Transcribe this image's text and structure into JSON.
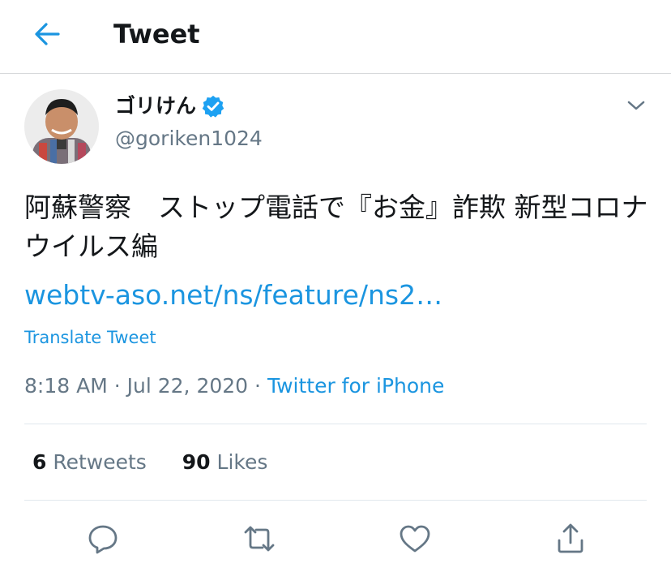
{
  "header": {
    "title": "Tweet"
  },
  "user": {
    "display_name": "ゴリけん",
    "handle": "@goriken1024"
  },
  "tweet": {
    "text": "阿蘇警察　ストップ電話で『お金』詐欺 新型コロナウイルス編",
    "link_text": "webtv-aso.net/ns/feature/ns2…",
    "translate_label": "Translate Tweet",
    "time": "8:18 AM",
    "date": "Jul 22, 2020",
    "separator": "·",
    "source": "Twitter for iPhone"
  },
  "stats": {
    "retweets_count": "6",
    "retweets_label": "Retweets",
    "likes_count": "90",
    "likes_label": "Likes"
  },
  "colors": {
    "accent": "#1b95e0",
    "secondary_text": "#657786",
    "primary_text": "#14171a",
    "verified": "#1da1f2"
  },
  "icons": [
    "back-arrow-icon",
    "verified-badge-icon",
    "chevron-down-icon",
    "reply-icon",
    "retweet-icon",
    "like-icon",
    "share-icon"
  ]
}
